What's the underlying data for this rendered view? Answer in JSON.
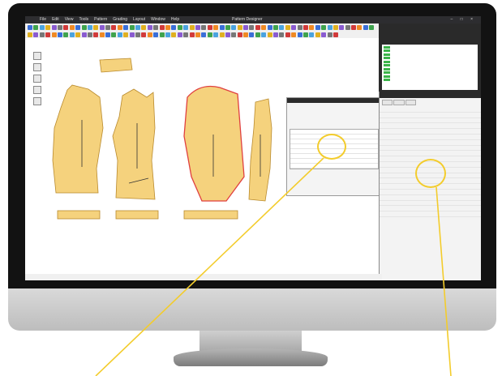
{
  "app": {
    "title": "Pattern Designer",
    "menu": [
      "File",
      "Edit",
      "View",
      "Tools",
      "Pattern",
      "Grading",
      "Layout",
      "Window",
      "Help"
    ],
    "window_controls": "– □ ×"
  },
  "toolbar_colors": [
    "#3a6fd8",
    "#e0b020",
    "#d13a3a",
    "#3fa34d",
    "#8a5bd0",
    "#f08a24",
    "#4aa3df",
    "#777777"
  ],
  "pattern_pieces": [
    {
      "name": "front-bodice-piece"
    },
    {
      "name": "back-bodice-piece"
    },
    {
      "name": "sleeve-piece-selected"
    },
    {
      "name": "under-sleeve-piece"
    },
    {
      "name": "collar-piece"
    },
    {
      "name": "waistband-piece-1"
    },
    {
      "name": "waistband-piece-2"
    },
    {
      "name": "waistband-piece-3"
    }
  ],
  "accent": "#f3cc2c",
  "piece_fill": "#f5d27d",
  "selection_outline": "#e04040"
}
